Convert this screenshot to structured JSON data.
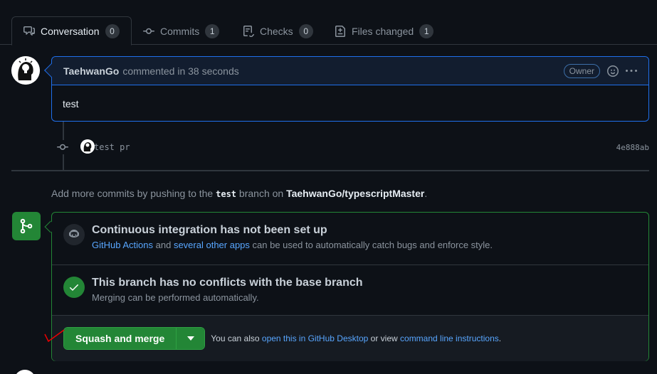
{
  "tabs": [
    {
      "label": "Conversation",
      "count": "0",
      "icon": "comment-discussion-icon"
    },
    {
      "label": "Commits",
      "count": "1",
      "icon": "git-commit-icon"
    },
    {
      "label": "Checks",
      "count": "0",
      "icon": "checklist-icon"
    },
    {
      "label": "Files changed",
      "count": "1",
      "icon": "file-diff-icon"
    }
  ],
  "comment": {
    "author": "TaehwanGo",
    "meta": "commented in 38 seconds",
    "role": "Owner",
    "body": "test"
  },
  "commit": {
    "message": "test pr",
    "sha": "4e888ab"
  },
  "hint": {
    "prefix": "Add more commits by pushing to the",
    "branch": "test",
    "middle": "branch on",
    "repo": "TaehwanGo/typescriptMaster",
    "suffix": "."
  },
  "ci": {
    "title": "Continuous integration has not been set up",
    "link1": "GitHub Actions",
    "and": "and",
    "link2": "several other apps",
    "rest": "can be used to automatically catch bugs and enforce style."
  },
  "conflicts": {
    "title": "This branch has no conflicts with the base branch",
    "sub": "Merging can be performed automatically."
  },
  "merge": {
    "button": "Squash and merge",
    "alt_prefix": "You can also",
    "alt_link1": "open this in GitHub Desktop",
    "alt_mid": "or view",
    "alt_link2": "command line instructions",
    "alt_suffix": "."
  },
  "colors": {
    "accent_blue": "#1f6feb",
    "success_green": "#238636",
    "link": "#58a6ff"
  }
}
